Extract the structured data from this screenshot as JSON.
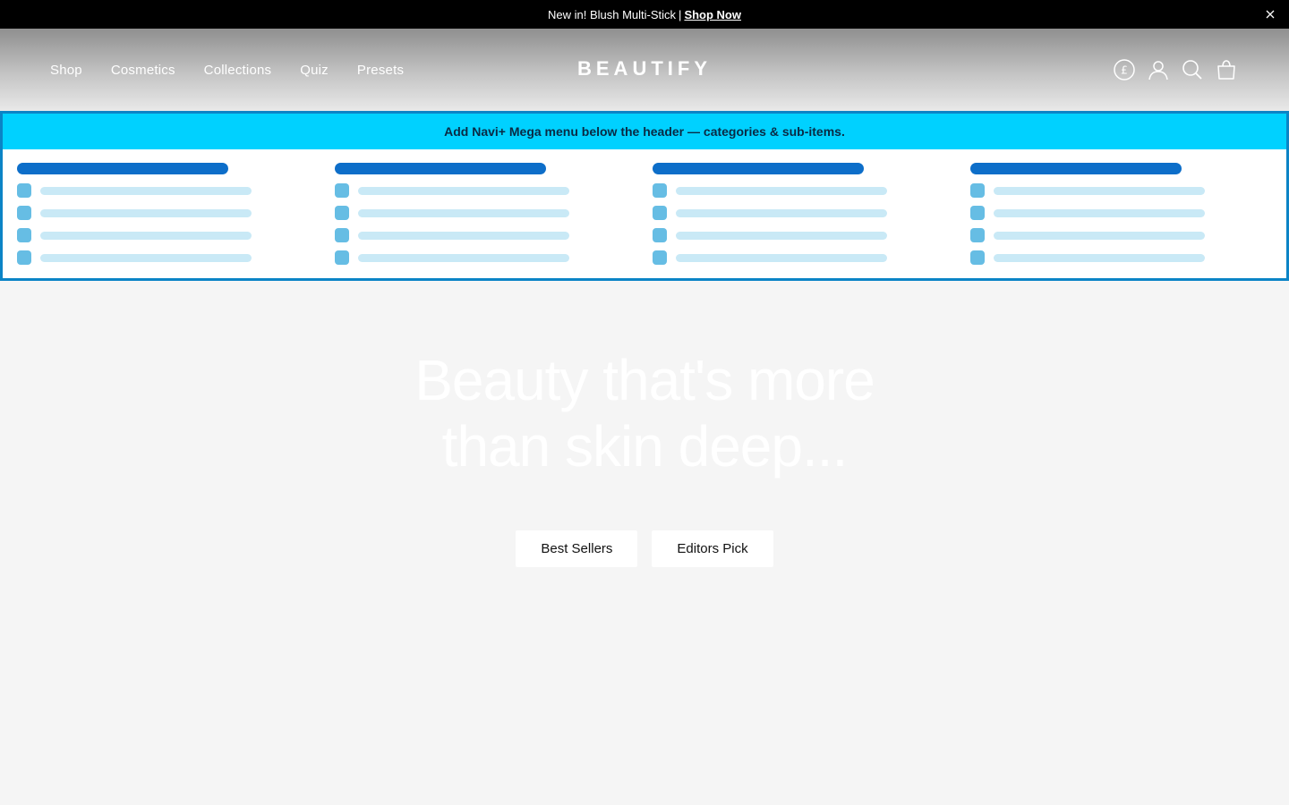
{
  "announcement": {
    "text": "New in! Blush Multi-Stick",
    "separator": "|",
    "link": "Shop Now"
  },
  "header": {
    "nav": [
      "Shop",
      "Cosmetics",
      "Collections",
      "Quiz",
      "Presets"
    ],
    "logo": "BEAUTIFY",
    "currency_symbol": "£",
    "icons": [
      "currency-icon",
      "account-icon",
      "search-icon",
      "cart-icon"
    ]
  },
  "mega_menu": {
    "banner": "Add Navi+ Mega menu below the header — categories & sub-items.",
    "column_count": 4,
    "rows_per_column": 4,
    "colors": {
      "banner": "#00d1ff",
      "heading": "#0d6ec9",
      "dot": "#66bde4",
      "bar": "#c9e9f6",
      "border": "#0b84c6"
    }
  },
  "hero": {
    "line1": "Beauty that's more",
    "line2": "than skin deep...",
    "buttons": [
      "Best Sellers",
      "Editors Pick"
    ]
  }
}
